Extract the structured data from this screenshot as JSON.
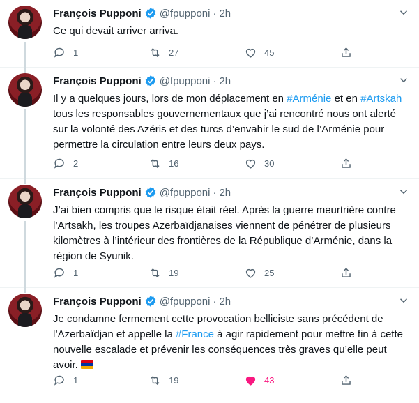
{
  "tweets": [
    {
      "name": "François Pupponi",
      "handle": "@fpupponi",
      "dot": "·",
      "time": "2h",
      "text": [
        "Ce qui devait arriver arriva."
      ],
      "replies": "1",
      "retweets": "27",
      "likes": "45",
      "liked": false
    },
    {
      "name": "François Pupponi",
      "handle": "@fpupponi",
      "dot": "·",
      "time": "2h",
      "text_parts": {
        "p1": "Il y a quelques jours, lors de mon déplacement en ",
        "tag1": "#Arménie",
        "p2": " et en ",
        "tag2": "#Artskah",
        "p3": " tous les responsables gouvernementaux que j’ai rencontré nous ont alerté sur la volonté des Azéris et des turcs d’envahir le sud de l’Arménie pour permettre la circulation entre leurs deux pays."
      },
      "replies": "2",
      "retweets": "16",
      "likes": "30",
      "liked": false
    },
    {
      "name": "François Pupponi",
      "handle": "@fpupponi",
      "dot": "·",
      "time": "2h",
      "text": [
        "J’ai bien compris que le risque était réel. Après la guerre meurtrière contre l’Artsakh, les troupes Azerbaïdjanaises viennent de pénétrer de plusieurs kilomètres à l’intérieur des frontières de la République d’Arménie, dans la région de Syunik."
      ],
      "replies": "1",
      "retweets": "19",
      "likes": "25",
      "liked": false
    },
    {
      "name": "François Pupponi",
      "handle": "@fpupponi",
      "dot": "·",
      "time": "2h",
      "text_parts": {
        "p1": "Je condamne fermement cette provocation belliciste sans précédent de l’Azerbaïdjan et appelle la ",
        "tag1": "#France",
        "p2": " à agir rapidement pour mettre fin à cette nouvelle escalade et prévenir les conséquences très graves qu’elle peut avoir."
      },
      "replies": "1",
      "retweets": "19",
      "likes": "43",
      "liked": true
    }
  ],
  "colors": {
    "accent": "#1d9bf0",
    "like": "#f91880",
    "muted": "#536471",
    "text": "#0f1419"
  },
  "icons": {
    "verified": "verified-badge-icon",
    "more": "more-icon",
    "reply": "reply-icon",
    "retweet": "retweet-icon",
    "like": "heart-icon",
    "share": "share-icon",
    "flag": "armenia-flag-icon"
  }
}
